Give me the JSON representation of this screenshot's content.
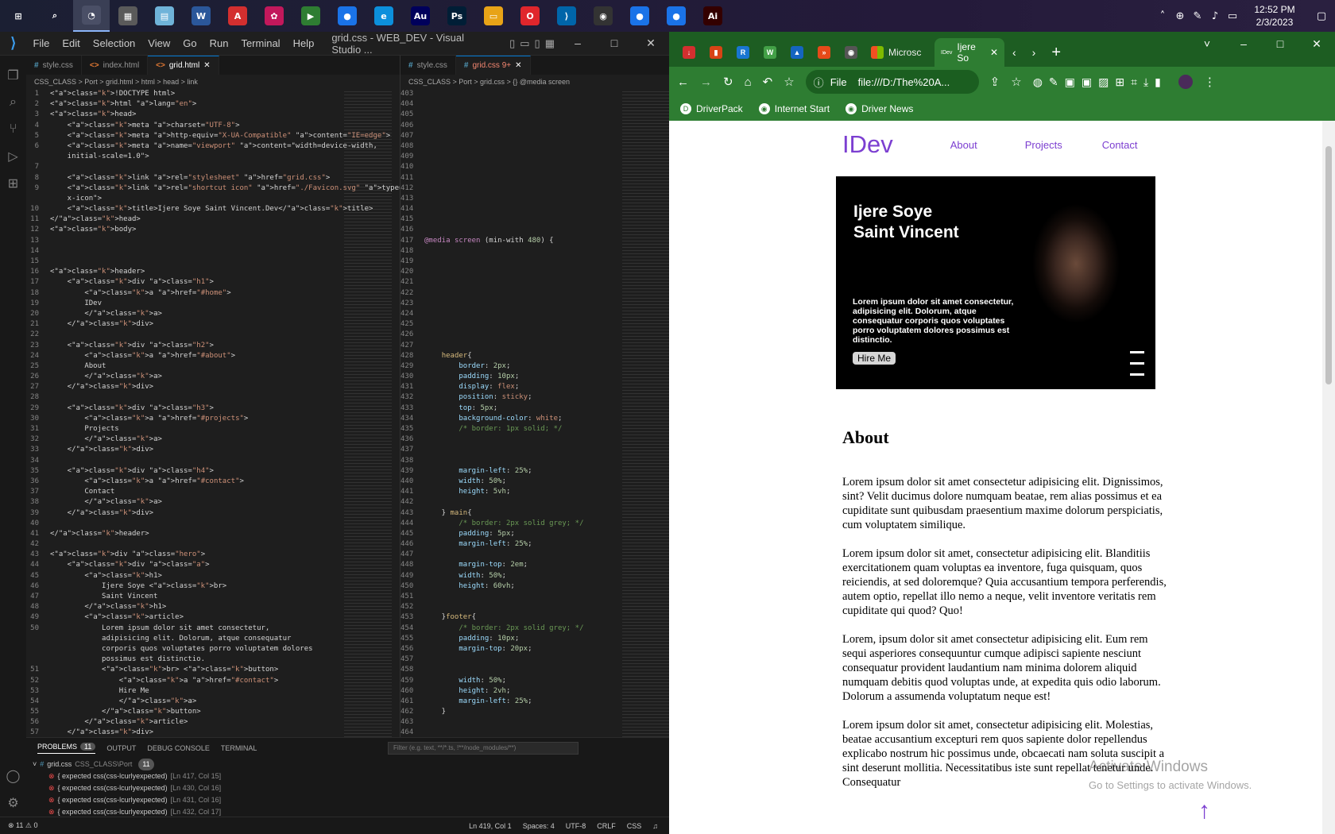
{
  "taskbar": {
    "apps": [
      {
        "name": "start-icon",
        "glyph": "⊞",
        "color": "transparent"
      },
      {
        "name": "search-icon",
        "glyph": "⌕",
        "color": "transparent"
      },
      {
        "name": "photos-icon",
        "glyph": "◔",
        "color": "#4a4f66"
      },
      {
        "name": "calculator-icon",
        "glyph": "▦",
        "color": "#5a5a5a"
      },
      {
        "name": "notebook-icon",
        "glyph": "▤",
        "color": "#6fb3d9"
      },
      {
        "name": "word-icon",
        "glyph": "W",
        "color": "#2b579a"
      },
      {
        "name": "pdf-icon",
        "glyph": "A",
        "color": "#d32f2f"
      },
      {
        "name": "paint-icon",
        "glyph": "✿",
        "color": "#c2185b"
      },
      {
        "name": "terminal-icon",
        "glyph": "▶",
        "color": "#2e7d32"
      },
      {
        "name": "chrome-icon",
        "glyph": "●",
        "color": "#1a73e8"
      },
      {
        "name": "edge-icon",
        "glyph": "e",
        "color": "#0c8fdc"
      },
      {
        "name": "audition-icon",
        "glyph": "Au",
        "color": "#00005b"
      },
      {
        "name": "photoshop-icon",
        "glyph": "Ps",
        "color": "#001e36"
      },
      {
        "name": "file-explorer-icon",
        "glyph": "▭",
        "color": "#e8a317"
      },
      {
        "name": "opera-icon",
        "glyph": "O",
        "color": "#e0262c"
      },
      {
        "name": "vscode-icon",
        "glyph": "⟩",
        "color": "#0065a9"
      },
      {
        "name": "obs-icon",
        "glyph": "◉",
        "color": "#333"
      },
      {
        "name": "chrome-icon-2",
        "glyph": "●",
        "color": "#1a73e8"
      },
      {
        "name": "chrome-icon-3",
        "glyph": "●",
        "color": "#1a73e8"
      },
      {
        "name": "illustrator-icon",
        "glyph": "Ai",
        "color": "#330000"
      }
    ],
    "time": "12:52 PM",
    "date": "2/3/2023",
    "tray_icons": [
      "chevron-up-icon",
      "globe-icon",
      "pen-icon",
      "volume-icon",
      "battery-icon"
    ]
  },
  "vscode": {
    "menu": [
      "File",
      "Edit",
      "Selection",
      "View",
      "Go",
      "Run",
      "Terminal",
      "Help"
    ],
    "title": "grid.css - WEB_DEV - Visual Studio ...",
    "left_tabs": [
      {
        "label": "style.css",
        "icon": "#",
        "color": "#519aba",
        "active": false
      },
      {
        "label": "index.html",
        "icon": "<>",
        "color": "#e37933",
        "active": false
      },
      {
        "label": "grid.html",
        "icon": "<>",
        "color": "#e37933",
        "active": true
      }
    ],
    "right_tabs": [
      {
        "label": "style.css",
        "icon": "#",
        "color": "#519aba",
        "active": false
      },
      {
        "label": "grid.css 9+",
        "icon": "#",
        "color": "#519aba",
        "active": true
      }
    ],
    "left_breadcrumb": "CSS_CLASS > Port > grid.html > html > head > link",
    "right_breadcrumb": "CSS_CLASS > Port > grid.css > {} @media screen",
    "html_lines": [
      {
        "n": "1",
        "code": "<!DOCTYPE html>"
      },
      {
        "n": "2",
        "code": "<html lang=\"en\">"
      },
      {
        "n": "3",
        "code": "<head>"
      },
      {
        "n": "4",
        "code": "    <meta charset=\"UTF-8\">"
      },
      {
        "n": "5",
        "code": "    <meta http-equiv=\"X-UA-Compatible\" content=\"IE=edge\">"
      },
      {
        "n": "6",
        "code": "    <meta name=\"viewport\" content=\"width=device-width,"
      },
      {
        "n": "",
        "code": "    initial-scale=1.0\">"
      },
      {
        "n": "7",
        "code": ""
      },
      {
        "n": "8",
        "code": "    <link rel=\"stylesheet\" href=\"grid.css\">"
      },
      {
        "n": "9",
        "code": "    <link rel=\"shortcut icon\" href=\"./Favicon.svg\" type=\"image/"
      },
      {
        "n": "",
        "code": "    x-icon\">"
      },
      {
        "n": "10",
        "code": "    <title>Ijere Soye Saint Vincent.Dev</title>"
      },
      {
        "n": "11",
        "code": "</head>"
      },
      {
        "n": "12",
        "code": "<body>"
      },
      {
        "n": "13",
        "code": ""
      },
      {
        "n": "14",
        "code": ""
      },
      {
        "n": "15",
        "code": ""
      },
      {
        "n": "16",
        "code": "<header>"
      },
      {
        "n": "17",
        "code": "    <div class=\"h1\">"
      },
      {
        "n": "18",
        "code": "        <a href=\"#home\">"
      },
      {
        "n": "19",
        "code": "        IDev"
      },
      {
        "n": "20",
        "code": "        </a>"
      },
      {
        "n": "21",
        "code": "    </div>"
      },
      {
        "n": "22",
        "code": ""
      },
      {
        "n": "23",
        "code": "    <div class=\"h2\">"
      },
      {
        "n": "24",
        "code": "        <a href=\"#about\">"
      },
      {
        "n": "25",
        "code": "        About"
      },
      {
        "n": "26",
        "code": "        </a>"
      },
      {
        "n": "27",
        "code": "    </div>"
      },
      {
        "n": "28",
        "code": ""
      },
      {
        "n": "29",
        "code": "    <div class=\"h3\">"
      },
      {
        "n": "30",
        "code": "        <a href=\"#projects\">"
      },
      {
        "n": "31",
        "code": "        Projects"
      },
      {
        "n": "32",
        "code": "        </a>"
      },
      {
        "n": "33",
        "code": "    </div>"
      },
      {
        "n": "34",
        "code": ""
      },
      {
        "n": "35",
        "code": "    <div class=\"h4\">"
      },
      {
        "n": "36",
        "code": "        <a href=\"#contact\">"
      },
      {
        "n": "37",
        "code": "        Contact"
      },
      {
        "n": "38",
        "code": "        </a>"
      },
      {
        "n": "39",
        "code": "    </div>"
      },
      {
        "n": "40",
        "code": ""
      },
      {
        "n": "41",
        "code": "</header>"
      },
      {
        "n": "42",
        "code": ""
      },
      {
        "n": "43",
        "code": "<div class=\"hero\">"
      },
      {
        "n": "44",
        "code": "    <div class=\"a\">"
      },
      {
        "n": "45",
        "code": "        <h1>"
      },
      {
        "n": "46",
        "code": "            Ijere Soye <br>"
      },
      {
        "n": "47",
        "code": "            Saint Vincent"
      },
      {
        "n": "48",
        "code": "        </h1>"
      },
      {
        "n": "49",
        "code": "        <article>"
      },
      {
        "n": "50",
        "code": "            Lorem ipsum dolor sit amet consectetur,"
      },
      {
        "n": "",
        "code": "            adipisicing elit. Dolorum, atque consequatur"
      },
      {
        "n": "",
        "code": "            corporis quos voluptates porro voluptatem dolores"
      },
      {
        "n": "",
        "code": "            possimus est distinctio."
      },
      {
        "n": "51",
        "code": "            <br> <button>"
      },
      {
        "n": "52",
        "code": "                <a href=\"#contact\">"
      },
      {
        "n": "53",
        "code": "                Hire Me"
      },
      {
        "n": "54",
        "code": "                </a>"
      },
      {
        "n": "55",
        "code": "            </button>"
      },
      {
        "n": "56",
        "code": "        </article>"
      },
      {
        "n": "57",
        "code": "    </div>"
      }
    ],
    "css_lines": [
      {
        "n": "403",
        "code": ""
      },
      {
        "n": "404",
        "code": ""
      },
      {
        "n": "405",
        "code": ""
      },
      {
        "n": "406",
        "code": ""
      },
      {
        "n": "407",
        "code": ""
      },
      {
        "n": "408",
        "code": ""
      },
      {
        "n": "409",
        "code": ""
      },
      {
        "n": "410",
        "code": ""
      },
      {
        "n": "411",
        "code": ""
      },
      {
        "n": "412",
        "code": ""
      },
      {
        "n": "413",
        "code": ""
      },
      {
        "n": "414",
        "code": ""
      },
      {
        "n": "415",
        "code": ""
      },
      {
        "n": "416",
        "code": ""
      },
      {
        "n": "417",
        "code": "@media screen (min-with 480) {"
      },
      {
        "n": "418",
        "code": ""
      },
      {
        "n": "419",
        "code": ""
      },
      {
        "n": "420",
        "code": ""
      },
      {
        "n": "421",
        "code": ""
      },
      {
        "n": "422",
        "code": ""
      },
      {
        "n": "423",
        "code": ""
      },
      {
        "n": "424",
        "code": ""
      },
      {
        "n": "425",
        "code": ""
      },
      {
        "n": "426",
        "code": ""
      },
      {
        "n": "427",
        "code": ""
      },
      {
        "n": "428",
        "code": "    header{"
      },
      {
        "n": "429",
        "code": "        border: 2px;"
      },
      {
        "n": "430",
        "code": "        padding: 10px;"
      },
      {
        "n": "431",
        "code": "        display: flex;"
      },
      {
        "n": "432",
        "code": "        position: sticky;"
      },
      {
        "n": "433",
        "code": "        top: 5px;"
      },
      {
        "n": "434",
        "code": "        background-color: white;"
      },
      {
        "n": "435",
        "code": "        /* border: 1px solid; */"
      },
      {
        "n": "436",
        "code": ""
      },
      {
        "n": "437",
        "code": ""
      },
      {
        "n": "438",
        "code": ""
      },
      {
        "n": "439",
        "code": "        margin-left: 25%;"
      },
      {
        "n": "440",
        "code": "        width: 50%;"
      },
      {
        "n": "441",
        "code": "        height: 5vh;"
      },
      {
        "n": "442",
        "code": ""
      },
      {
        "n": "443",
        "code": "    } main{"
      },
      {
        "n": "444",
        "code": "        /* border: 2px solid grey; */"
      },
      {
        "n": "445",
        "code": "        padding: 5px;"
      },
      {
        "n": "446",
        "code": "        margin-left: 25%;"
      },
      {
        "n": "447",
        "code": ""
      },
      {
        "n": "448",
        "code": "        margin-top: 2em;"
      },
      {
        "n": "449",
        "code": "        width: 50%;"
      },
      {
        "n": "450",
        "code": "        height: 60vh;"
      },
      {
        "n": "451",
        "code": ""
      },
      {
        "n": "452",
        "code": ""
      },
      {
        "n": "453",
        "code": "    }footer{"
      },
      {
        "n": "454",
        "code": "        /* border: 2px solid grey; */"
      },
      {
        "n": "455",
        "code": "        padding: 10px;"
      },
      {
        "n": "456",
        "code": "        margin-top: 20px;"
      },
      {
        "n": "457",
        "code": ""
      },
      {
        "n": "458",
        "code": ""
      },
      {
        "n": "459",
        "code": "        width: 50%;"
      },
      {
        "n": "460",
        "code": "        height: 2vh;"
      },
      {
        "n": "461",
        "code": "        margin-left: 25%;"
      },
      {
        "n": "462",
        "code": "    }"
      },
      {
        "n": "463",
        "code": ""
      },
      {
        "n": "464",
        "code": ""
      }
    ],
    "panel": {
      "tabs": [
        "PROBLEMS",
        "OUTPUT",
        "DEBUG CONSOLE",
        "TERMINAL"
      ],
      "problem_count": "11",
      "filter_placeholder": "Filter (e.g. text, **/*.ts, !**/node_modules/**)",
      "file": "grid.css",
      "file_path": "CSS_CLASS\\Port",
      "file_count": "11",
      "problems": [
        {
          "msg": "{ expected css(css-lcurlyexpected)",
          "pos": "[Ln 417, Col 15]"
        },
        {
          "msg": "{ expected css(css-lcurlyexpected)",
          "pos": "[Ln 430, Col 16]"
        },
        {
          "msg": "{ expected css(css-lcurlyexpected)",
          "pos": "[Ln 431, Col 16]"
        },
        {
          "msg": "{ expected css(css-lcurlyexpected)",
          "pos": "[Ln 432, Col 17]"
        }
      ]
    },
    "status": {
      "errors": "⊗ 11 ⚠ 0",
      "position": "Ln 419, Col 1",
      "spaces": "Spaces: 4",
      "encoding": "UTF-8",
      "eol": "CRLF",
      "lang": "CSS"
    }
  },
  "chrome": {
    "tab_icons": [
      {
        "name": "download-tab-icon",
        "glyph": "↓",
        "color": "#d32f2f"
      },
      {
        "name": "office-tab-icon",
        "glyph": "▮",
        "color": "#d84315"
      },
      {
        "name": "repo-tab-icon",
        "glyph": "R",
        "color": "#1976d2"
      },
      {
        "name": "w-tab-icon",
        "glyph": "W",
        "color": "#43a047"
      },
      {
        "name": "profile-tab-icon",
        "glyph": "▲",
        "color": "#1565c0"
      },
      {
        "name": "forward-tab-icon",
        "glyph": "»",
        "color": "#e64a19"
      },
      {
        "name": "globe-tab-icon",
        "glyph": "◉",
        "color": "#555"
      }
    ],
    "tab_microsoft": "Microsc",
    "tab_active": "Ijere So",
    "tab_active_favicon": "IDev",
    "url": "file:///D:/The%20A...",
    "url_scheme": "File",
    "bookmarks": [
      "DriverPack",
      "Internet Start",
      "Driver News"
    ],
    "page": {
      "logo": "IDev",
      "nav": [
        "About",
        "Projects",
        "Contact"
      ],
      "hero_name_1": "Ijere Soye",
      "hero_name_2": "Saint Vincent",
      "hero_text": "Lorem ipsum dolor sit amet consectetur, adipisicing elit. Dolorum, atque consequatur corporis quos voluptates porro voluptatem dolores possimus est distinctio.",
      "hire_button": "Hire Me",
      "about_heading": "About",
      "paragraphs": [
        "Lorem ipsum dolor sit amet consectetur adipisicing elit. Dignissimos, sint? Velit ducimus dolore numquam beatae, rem alias possimus et ea cupiditate sunt quibusdam praesentium maxime dolorum perspiciatis, cum voluptatem similique.",
        "Lorem ipsum dolor sit amet, consectetur adipisicing elit. Blanditiis exercitationem quam voluptas ea inventore, fuga quisquam, quos reiciendis, at sed doloremque? Quia accusantium tempora perferendis, autem optio, repellat illo nemo a neque, velit inventore veritatis rem cupiditate qui quod? Quo!",
        "Lorem, ipsum dolor sit amet consectetur adipisicing elit. Eum rem sequi asperiores consequuntur cumque adipisci sapiente nesciunt consequatur provident laudantium nam minima dolorem aliquid numquam debitis quod voluptas unde, at expedita quis odio laborum. Dolorum a assumenda voluptatum neque est!",
        "Lorem ipsum dolor sit amet, consectetur adipisicing elit. Molestias, beatae accusantium excepturi rem quos sapiente dolor repellendus explicabo nostrum hic possimus unde, obcaecati nam soluta suscipit a sint deserunt mollitia. Necessitatibus iste sunt repellat tenetur unde. Consequatur"
      ]
    },
    "watermark_1": "Activate Windows",
    "watermark_2": "Go to Settings to activate Windows."
  }
}
